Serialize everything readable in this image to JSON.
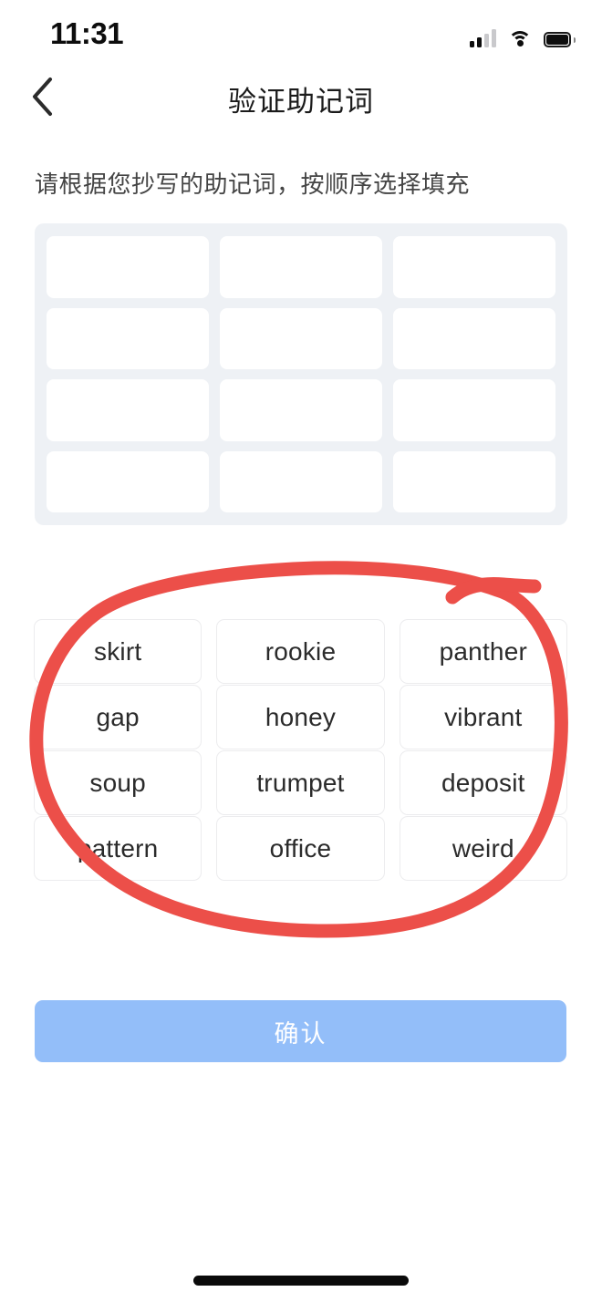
{
  "status_bar": {
    "time": "11:31",
    "signal_icon": "cellular-signal-icon",
    "signal_bars_filled": 2,
    "signal_bars_total": 4,
    "wifi_icon": "wifi-icon",
    "battery_icon": "battery-full-icon"
  },
  "nav": {
    "back_icon": "chevron-left-icon",
    "title": "验证助记词"
  },
  "instruction": "请根据您抄写的助记词，按顺序选择填充",
  "slot_panel": {
    "rows": 4,
    "columns": 3,
    "slots": [
      "",
      "",
      "",
      "",
      "",
      "",
      "",
      "",
      "",
      "",
      "",
      ""
    ],
    "background_color": "#eef1f5",
    "slot_color": "#ffffff"
  },
  "word_bank": {
    "rows": 4,
    "columns": 3,
    "words": [
      "skirt",
      "rookie",
      "panther",
      "gap",
      "honey",
      "vibrant",
      "soup",
      "trumpet",
      "deposit",
      "pattern",
      "office",
      "weird"
    ]
  },
  "confirm_button": {
    "label": "确认",
    "color": "#93bef9",
    "text_color": "#ffffff",
    "state": "disabled"
  },
  "annotation": {
    "type": "hand-drawn-circle",
    "color": "#ec4f49",
    "target": "word-bank"
  },
  "home_indicator": {
    "color": "#0a0a0a"
  }
}
